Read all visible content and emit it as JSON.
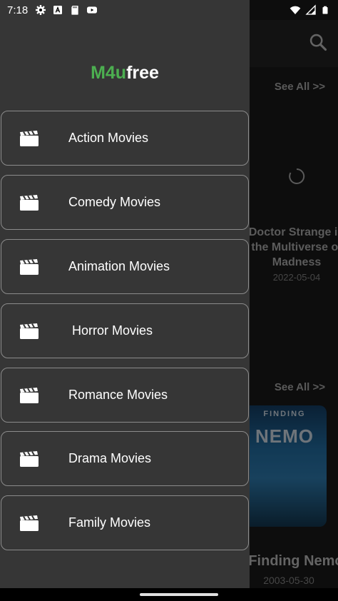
{
  "status_bar": {
    "time": "7:18",
    "icons": [
      "gear-icon",
      "font-icon",
      "sd-card-icon",
      "youtube-icon"
    ],
    "right_icons": [
      "wifi-icon",
      "signal-icon",
      "battery-icon"
    ]
  },
  "background_app": {
    "search_icon": "search-icon",
    "see_all_label": "See All >>",
    "see_all_label_2": "See All >>",
    "movie_1": {
      "title": "Doctor Strange in the Multiverse of Madness",
      "date": "2022-05-04"
    },
    "movie_2": {
      "title": "Finding Nemo",
      "date": "2003-05-30",
      "poster_sub": "FINDING",
      "poster_title": "NEMO"
    }
  },
  "drawer": {
    "brand_prefix": "M4u",
    "brand_suffix": "free",
    "brand_prefix_color": "#4caf50",
    "items": [
      {
        "label": "Action Movies",
        "icon": "clapperboard-icon"
      },
      {
        "label": "Comedy Movies",
        "icon": "clapperboard-icon"
      },
      {
        "label": "Animation Movies",
        "icon": "clapperboard-icon"
      },
      {
        "label": " Horror Movies",
        "icon": "clapperboard-icon"
      },
      {
        "label": "Romance Movies",
        "icon": "clapperboard-icon"
      },
      {
        "label": "Drama Movies",
        "icon": "clapperboard-icon"
      },
      {
        "label": "Family Movies",
        "icon": "clapperboard-icon"
      }
    ]
  }
}
